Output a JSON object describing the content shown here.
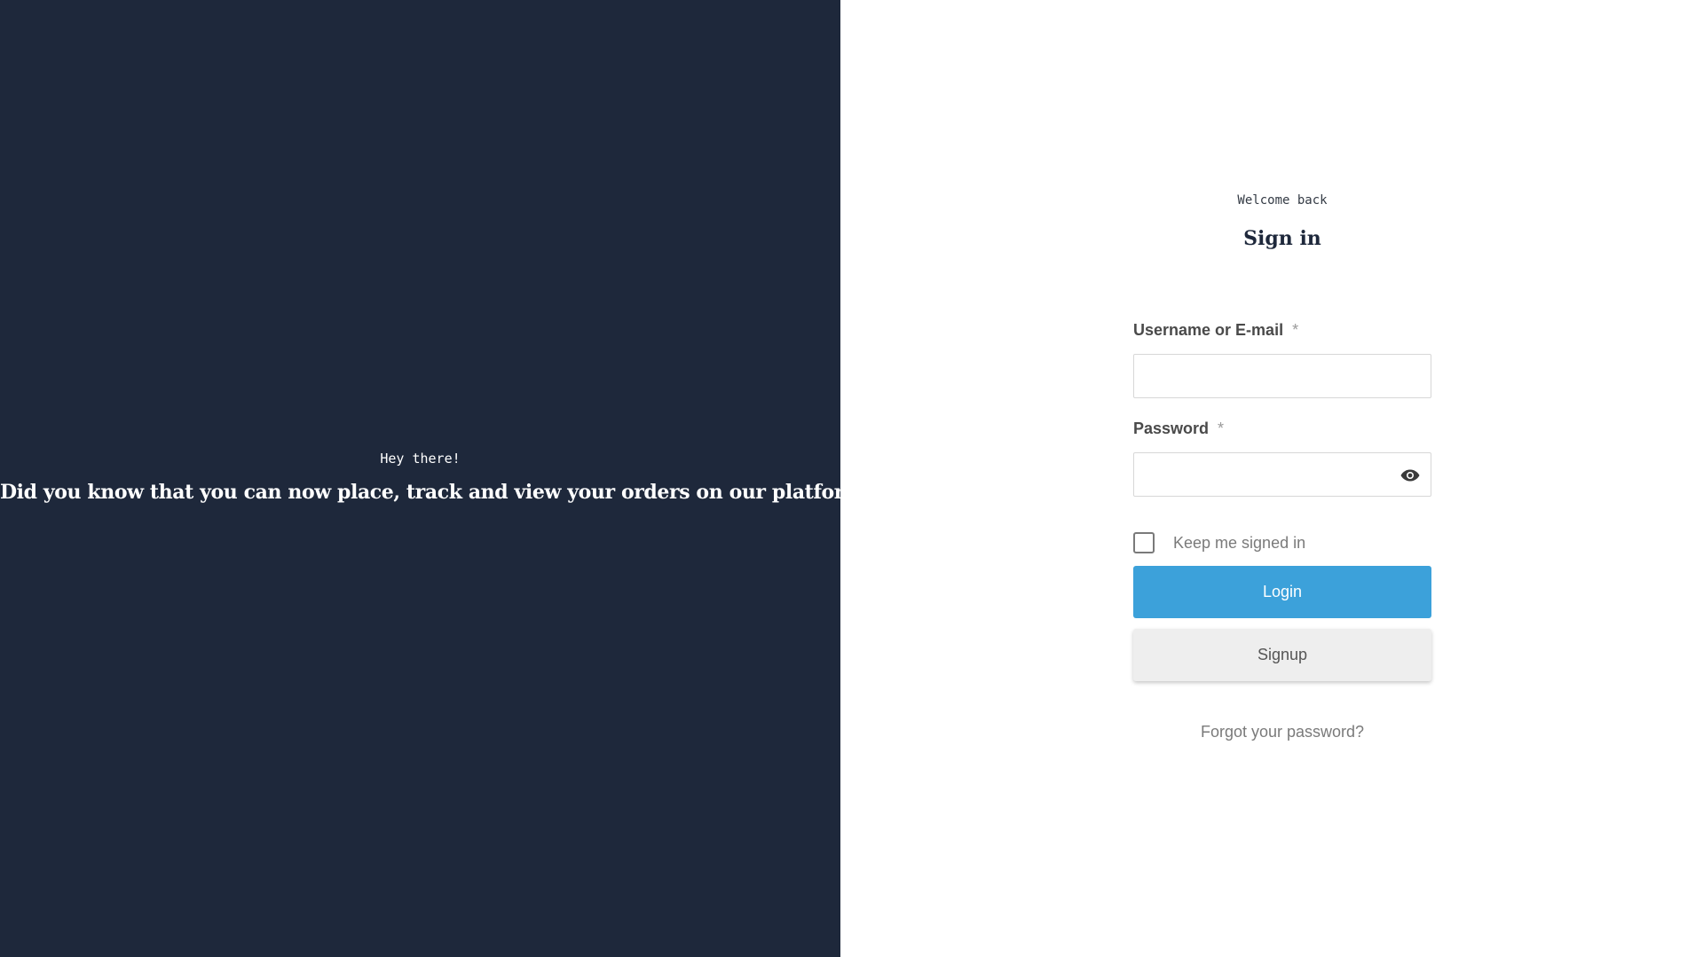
{
  "hero": {
    "kicker": "Hey there!",
    "headline": "Did you know that you can now place, track and view your orders on our platform?",
    "background_color": "#1e283b"
  },
  "auth": {
    "welcome": "Welcome back",
    "title": "Sign in",
    "username": {
      "label": "Username or E-mail",
      "required_mark": "*",
      "value": ""
    },
    "password": {
      "label": "Password",
      "required_mark": "*",
      "value": "",
      "toggle_icon": "eye-icon"
    },
    "remember": {
      "label": "Keep me signed in",
      "checked": false
    },
    "login_label": "Login",
    "signup_label": "Signup",
    "forgot_label": "Forgot your password?",
    "accent_color": "#3ca1da"
  }
}
